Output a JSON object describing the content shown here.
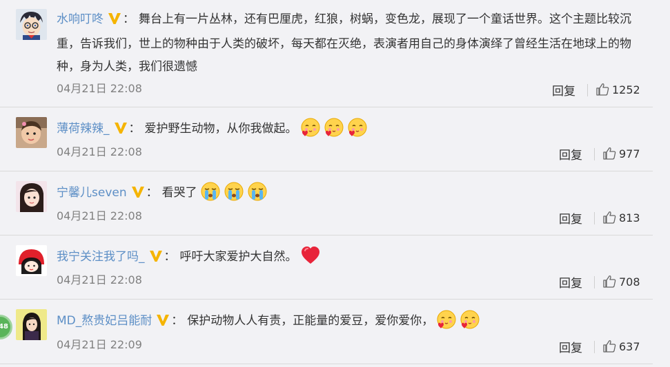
{
  "comments": [
    {
      "username": "水响叮咚",
      "colon": "：",
      "text": "舞台上有一片丛林，还有巴厘虎，红狼，树蜗，变色龙，展现了一个童话世界。这个主题比较沉重，告诉我们，世上的物种由于人类的破坏，每天都在灭绝，表演者用自己的身体演绎了曾经生活在地球上的物种，身为人类，我们很遗憾",
      "time": "04月21日 22:08",
      "reply_label": "回复",
      "likes": "1252"
    },
    {
      "username": "薄荷辣辣_",
      "colon": "：",
      "text": "爱护野生动物，从你我做起。",
      "emojis": [
        "love-emoji",
        "love-emoji",
        "love-emoji"
      ],
      "time": "04月21日 22:08",
      "reply_label": "回复",
      "likes": "977"
    },
    {
      "username": "宁馨儿seven",
      "colon": "：",
      "text": "看哭了",
      "emojis": [
        "crying-emoji",
        "crying-emoji",
        "crying-emoji"
      ],
      "time": "04月21日 22:08",
      "reply_label": "回复",
      "likes": "813"
    },
    {
      "username": "我宁关注我了吗_",
      "colon": "：",
      "text": "呼吁大家爱护大自然。",
      "emojis": [
        "heart-emoji"
      ],
      "time": "04月21日 22:08",
      "reply_label": "回复",
      "likes": "708"
    },
    {
      "username": "MD_熬贵妃吕能耐",
      "colon": "：",
      "text": "保护动物人人有责，正能量的爱豆，爱你爱你，",
      "emojis": [
        "love-emoji",
        "love-emoji"
      ],
      "time": "04月21日 22:09",
      "reply_label": "回复",
      "likes": "637"
    }
  ],
  "side_badge": "48",
  "colors": {
    "background": "#f2f2f5",
    "username": "#5d8fc6",
    "vip_badge": "#f5b400",
    "meta_text": "#808080"
  }
}
